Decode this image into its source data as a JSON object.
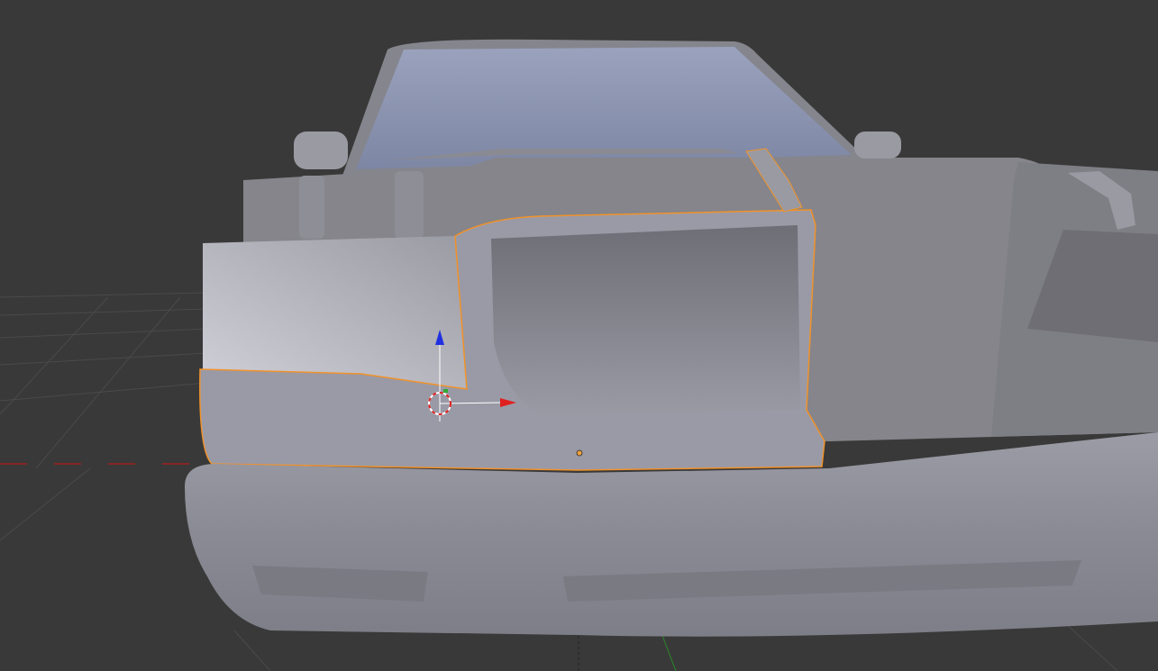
{
  "viewport": {
    "background_color": "#393939",
    "grid_color": "#4a4a4a",
    "x_axis_color": "#a02020",
    "y_axis_color": "#2a8a2a",
    "selection_outline_color": "#f0922a",
    "model_color": "#8c8c96",
    "windshield_color": "#8a93b0"
  },
  "gizmo": {
    "x_arrow_color": "#e02020",
    "z_arrow_color": "#2030e0",
    "icons": [
      "3d-cursor-icon",
      "transform-gizmo-icon",
      "origin-point-icon"
    ]
  }
}
